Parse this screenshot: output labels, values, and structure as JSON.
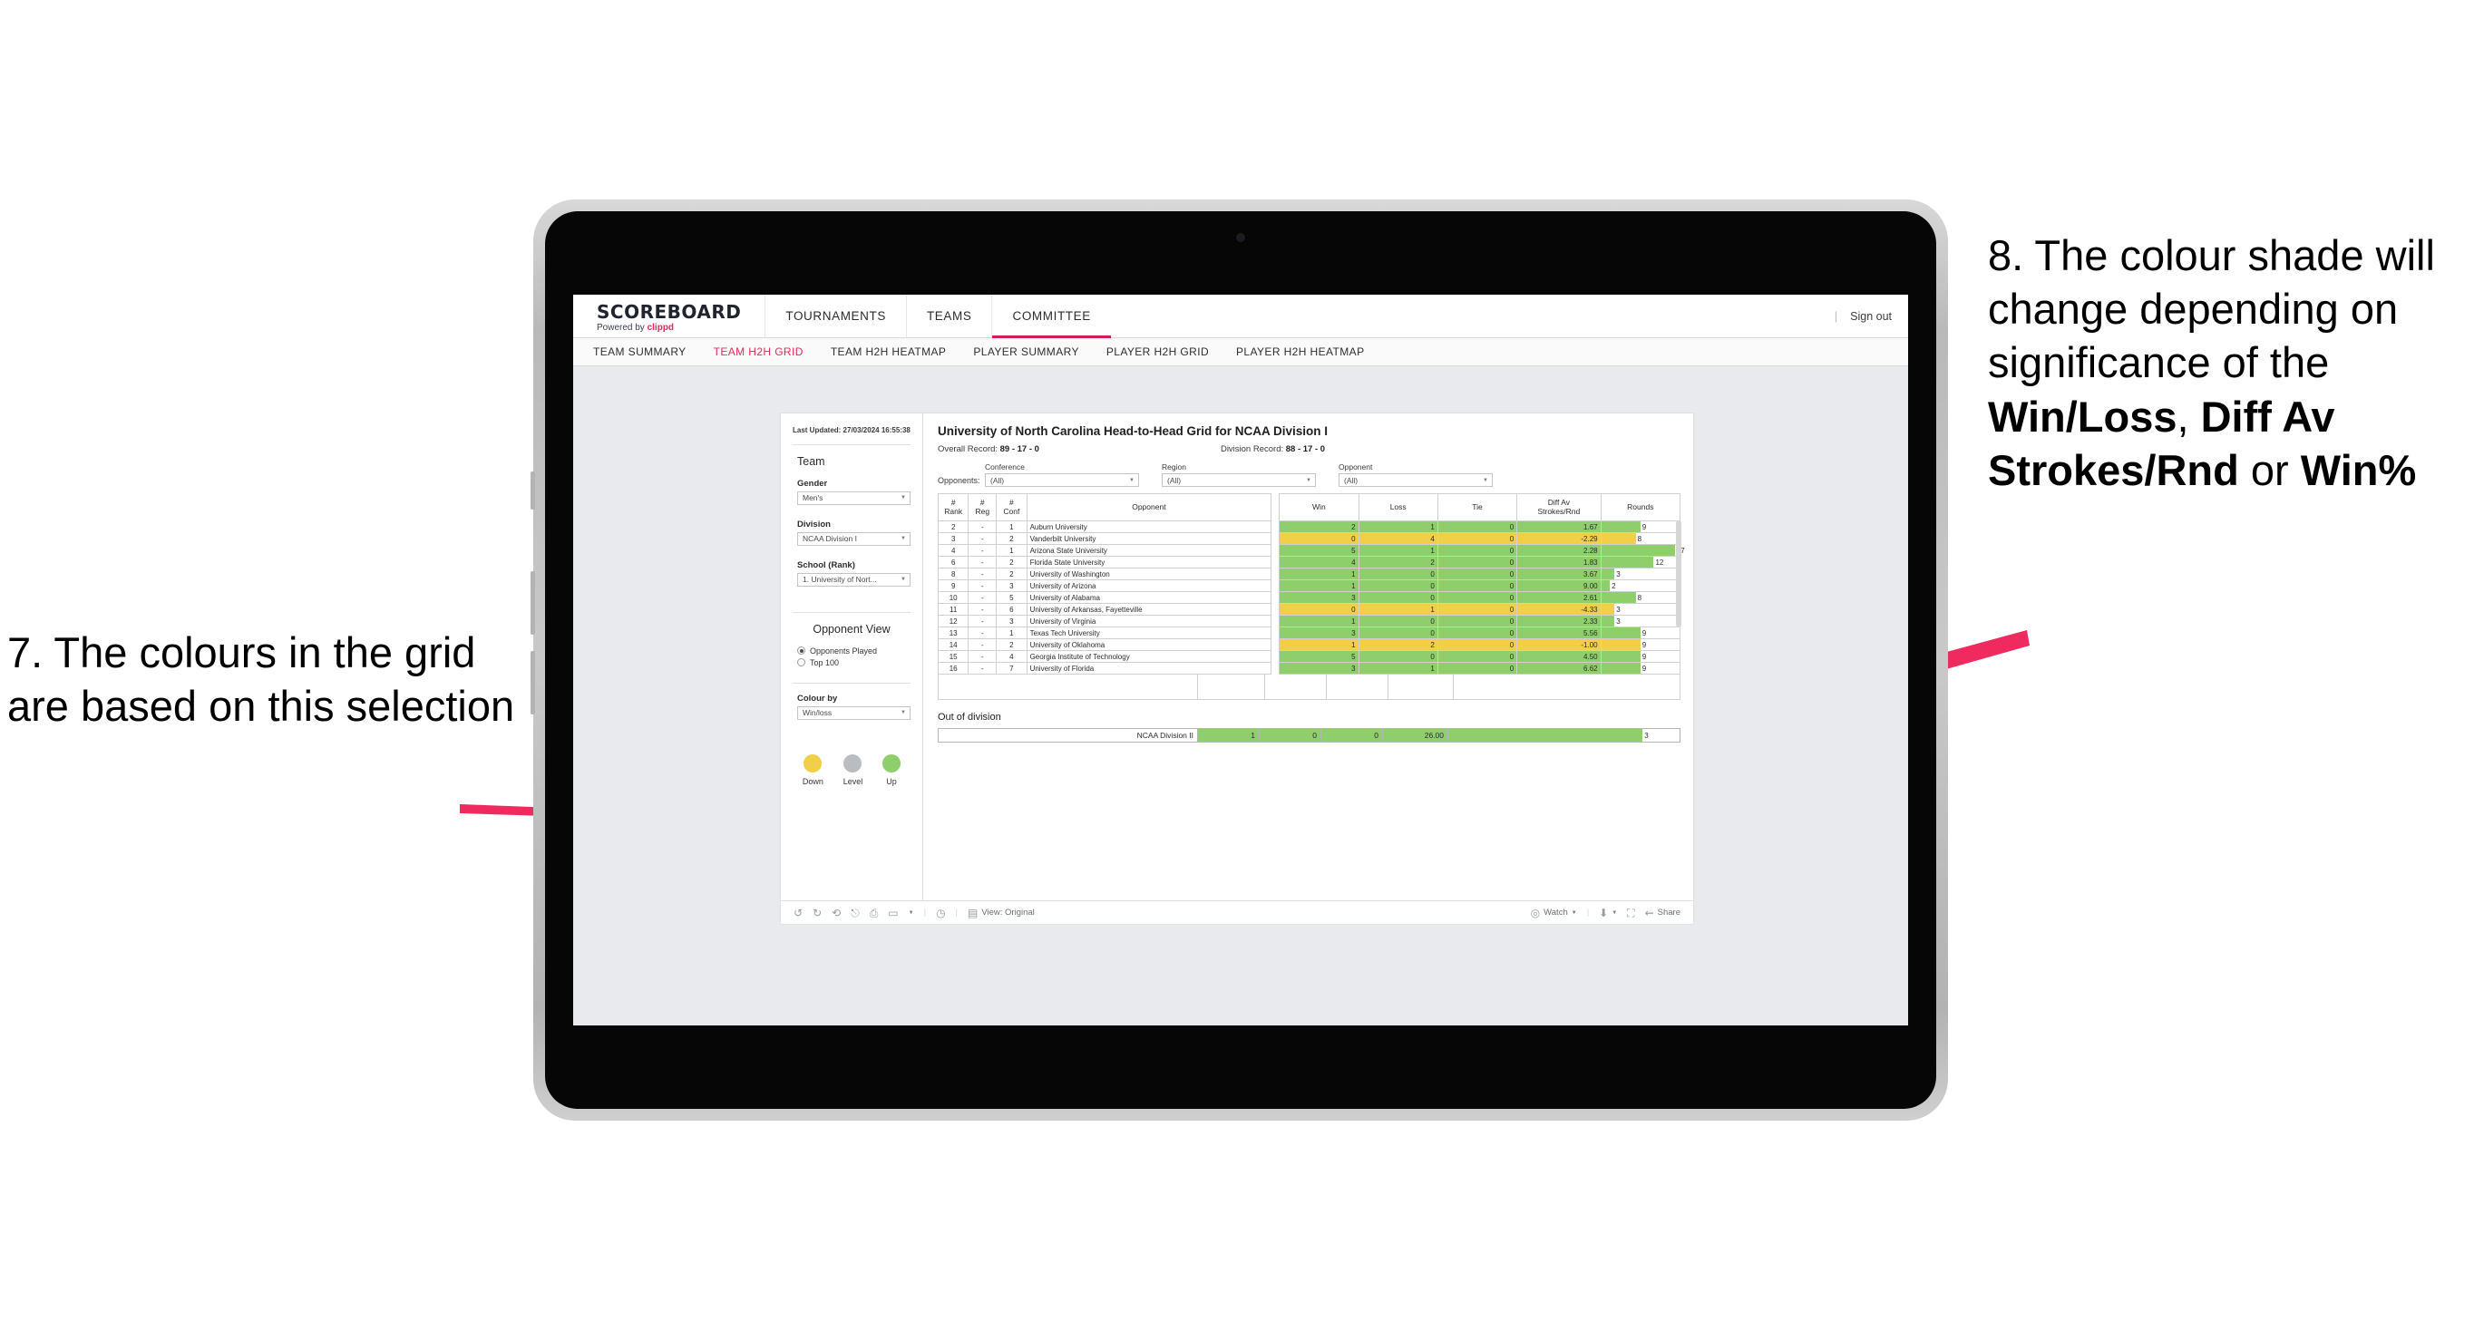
{
  "annotations": {
    "left": {
      "number": "7.",
      "text": "7. The colours in the grid are based on this selection"
    },
    "right": {
      "prefix": "8. The colour shade will change depending on significance of the ",
      "bold1": "Win/Loss",
      "mid1": ", ",
      "bold2": "Diff Av Strokes/Rnd",
      "mid2": " or ",
      "bold3": "Win%"
    },
    "arrow_color": "#ef2a5f"
  },
  "app": {
    "brand": {
      "title": "SCOREBOARD",
      "powered_prefix": "Powered by ",
      "powered_brand": "clippd"
    },
    "top_nav": [
      {
        "label": "TOURNAMENTS",
        "active": false
      },
      {
        "label": "TEAMS",
        "active": false
      },
      {
        "label": "COMMITTEE",
        "active": true
      }
    ],
    "sign_out": "Sign out",
    "separator": "|",
    "sub_nav": [
      {
        "label": "TEAM SUMMARY",
        "active": false
      },
      {
        "label": "TEAM H2H GRID",
        "active": true
      },
      {
        "label": "TEAM H2H HEATMAP",
        "active": false
      },
      {
        "label": "PLAYER SUMMARY",
        "active": false
      },
      {
        "label": "PLAYER H2H GRID",
        "active": false
      },
      {
        "label": "PLAYER H2H HEATMAP",
        "active": false
      }
    ]
  },
  "sidebar": {
    "last_updated": "Last Updated: 27/03/2024 16:55:38",
    "team_heading": "Team",
    "gender": {
      "label": "Gender",
      "value": "Men's"
    },
    "division": {
      "label": "Division",
      "value": "NCAA Division I"
    },
    "school": {
      "label": "School (Rank)",
      "value": "1. University of Nort..."
    },
    "opponent_view": {
      "heading": "Opponent View",
      "options": [
        {
          "label": "Opponents Played",
          "selected": true
        },
        {
          "label": "Top 100",
          "selected": false
        }
      ]
    },
    "colour_by": {
      "label": "Colour by",
      "value": "Win/loss"
    },
    "legend": [
      {
        "label": "Down",
        "color": "#f2cf49"
      },
      {
        "label": "Level",
        "color": "#b9bcc0"
      },
      {
        "label": "Up",
        "color": "#8ece6b"
      }
    ]
  },
  "main": {
    "title": "University of North Carolina Head-to-Head Grid for NCAA Division I",
    "overall_record_label": "Overall Record: ",
    "overall_record_value": "89 - 17 - 0",
    "division_record_label": "Division Record: ",
    "division_record_value": "88 - 17 - 0",
    "opponents_label": "Opponents:",
    "filters": [
      {
        "label": "Conference",
        "value": "(All)"
      },
      {
        "label": "Region",
        "value": "(All)"
      },
      {
        "label": "Opponent",
        "value": "(All)"
      }
    ],
    "out_of_division_title": "Out of division",
    "out_of_division_row": {
      "name": "NCAA Division II",
      "win": "1",
      "loss": "0",
      "tie": "0",
      "diff": "26.00",
      "rounds": "3",
      "state": "up",
      "bar_pct": 84
    }
  },
  "chart_data": {
    "type": "table",
    "title": "University of North Carolina Head-to-Head Grid for NCAA Division I",
    "columns": [
      "# Rank",
      "# Reg",
      "# Conf",
      "Opponent",
      "Win",
      "Loss",
      "Tie",
      "Diff Av Strokes/Rnd",
      "Rounds"
    ],
    "column_lines": [
      [
        "#",
        "Rank"
      ],
      [
        "#",
        "Reg"
      ],
      [
        "#",
        "Conf"
      ],
      [
        "",
        "Opponent"
      ],
      [
        "Win",
        ""
      ],
      [
        "Loss",
        ""
      ],
      [
        "Tie",
        ""
      ],
      [
        "Diff Av",
        "Strokes/Rnd"
      ],
      [
        "Rounds",
        ""
      ]
    ],
    "rows": [
      {
        "rank": "2",
        "reg": "-",
        "conf": "1",
        "opponent": "Auburn University",
        "win": "2",
        "loss": "1",
        "tie": "0",
        "diff": "1.67",
        "rounds": "9",
        "state": "up",
        "bar_pct": 50
      },
      {
        "rank": "3",
        "reg": "-",
        "conf": "2",
        "opponent": "Vanderbilt University",
        "win": "0",
        "loss": "4",
        "tie": "0",
        "diff": "-2.29",
        "rounds": "8",
        "state": "down",
        "bar_pct": 44
      },
      {
        "rank": "4",
        "reg": "-",
        "conf": "1",
        "opponent": "Arizona State University",
        "win": "5",
        "loss": "1",
        "tie": "0",
        "diff": "2.28",
        "rounds": "17",
        "state": "up",
        "bar_pct": 94
      },
      {
        "rank": "6",
        "reg": "-",
        "conf": "2",
        "opponent": "Florida State University",
        "win": "4",
        "loss": "2",
        "tie": "0",
        "diff": "1.83",
        "rounds": "12",
        "state": "up",
        "bar_pct": 67
      },
      {
        "rank": "8",
        "reg": "-",
        "conf": "2",
        "opponent": "University of Washington",
        "win": "1",
        "loss": "0",
        "tie": "0",
        "diff": "3.67",
        "rounds": "3",
        "state": "up",
        "bar_pct": 17
      },
      {
        "rank": "9",
        "reg": "-",
        "conf": "3",
        "opponent": "University of Arizona",
        "win": "1",
        "loss": "0",
        "tie": "0",
        "diff": "9.00",
        "rounds": "2",
        "state": "up",
        "bar_pct": 11
      },
      {
        "rank": "10",
        "reg": "-",
        "conf": "5",
        "opponent": "University of Alabama",
        "win": "3",
        "loss": "0",
        "tie": "0",
        "diff": "2.61",
        "rounds": "8",
        "state": "up",
        "bar_pct": 44
      },
      {
        "rank": "11",
        "reg": "-",
        "conf": "6",
        "opponent": "University of Arkansas, Fayetteville",
        "win": "0",
        "loss": "1",
        "tie": "0",
        "diff": "-4.33",
        "rounds": "3",
        "state": "down",
        "bar_pct": 17
      },
      {
        "rank": "12",
        "reg": "-",
        "conf": "3",
        "opponent": "University of Virginia",
        "win": "1",
        "loss": "0",
        "tie": "0",
        "diff": "2.33",
        "rounds": "3",
        "state": "up",
        "bar_pct": 17
      },
      {
        "rank": "13",
        "reg": "-",
        "conf": "1",
        "opponent": "Texas Tech University",
        "win": "3",
        "loss": "0",
        "tie": "0",
        "diff": "5.56",
        "rounds": "9",
        "state": "up",
        "bar_pct": 50
      },
      {
        "rank": "14",
        "reg": "-",
        "conf": "2",
        "opponent": "University of Oklahoma",
        "win": "1",
        "loss": "2",
        "tie": "0",
        "diff": "-1.00",
        "rounds": "9",
        "state": "down",
        "bar_pct": 50
      },
      {
        "rank": "15",
        "reg": "-",
        "conf": "4",
        "opponent": "Georgia Institute of Technology",
        "win": "5",
        "loss": "0",
        "tie": "0",
        "diff": "4.50",
        "rounds": "9",
        "state": "up",
        "bar_pct": 50
      },
      {
        "rank": "16",
        "reg": "-",
        "conf": "7",
        "opponent": "University of Florida",
        "win": "3",
        "loss": "1",
        "tie": "0",
        "diff": "6.62",
        "rounds": "9",
        "state": "up",
        "bar_pct": 50
      }
    ],
    "colors": {
      "up": "#8ece6b",
      "down": "#f2cf49",
      "level": "#b9bcc0"
    },
    "legend_position": "sidebar-bottom"
  },
  "toolbar": {
    "icons": [
      "undo-icon",
      "redo-icon",
      "revert-icon",
      "refresh-icon",
      "pause-icon",
      "alerts-icon",
      "dropdown-caret"
    ],
    "view_label": "View: Original",
    "watch_label": "Watch",
    "share_label": "Share"
  }
}
